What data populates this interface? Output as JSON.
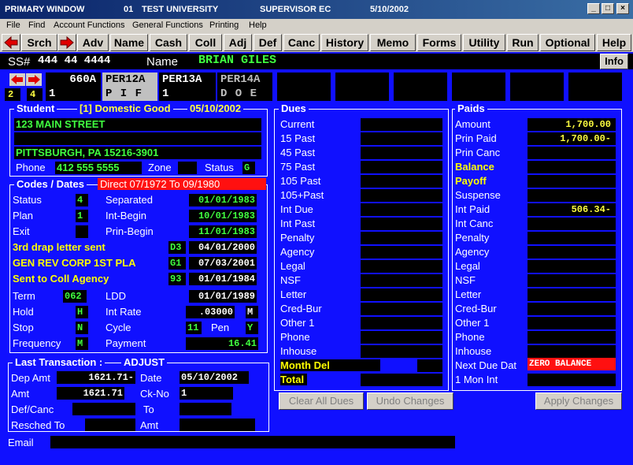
{
  "title": {
    "window": "PRIMARY WINDOW",
    "num": "01",
    "school": "TEST UNIVERSITY",
    "role": "SUPERVISOR",
    "role_code": "EC",
    "date": "5/10/2002"
  },
  "menu": [
    "File",
    "Find",
    "Account Functions",
    "General Functions",
    "Printing",
    "Help"
  ],
  "toolbar": [
    "Srch",
    "Adv",
    "Name",
    "Cash",
    "Coll",
    "Adj",
    "Def",
    "Canc",
    "History",
    "Memo",
    "Forms",
    "Utility",
    "Run",
    "Optional",
    "Help"
  ],
  "header": {
    "ss_label": "SS#",
    "ss": "444 44 4444",
    "name_label": "Name",
    "name": "BRIAN GILES",
    "info": "Info"
  },
  "tabs": [
    "660A",
    "PER12A",
    "PER13A",
    "PER14A"
  ],
  "tabs2": [
    "1",
    "P I F",
    "1",
    "D O E"
  ],
  "mini": [
    "2",
    "4"
  ],
  "student": {
    "title": "Student",
    "status_text": "[1] Domestic Good",
    "date": "05/10/2002",
    "addr1": "123 MAIN STREET",
    "addr2": "",
    "addr3": "PITTSBURGH, PA 15216-3901",
    "phone_label": "Phone",
    "phone": "412 555 5555",
    "zone_label": "Zone",
    "zone": "",
    "status_label": "Status",
    "status": "G"
  },
  "codes": {
    "title": "Codes / Dates",
    "direct": "Direct 07/1972 To 09/1980",
    "rows": [
      {
        "l": "Status",
        "v": "4",
        "l2": "Separated",
        "v2": "01/01/1983"
      },
      {
        "l": "Plan",
        "v": "1",
        "l2": "Int-Begin",
        "v2": "10/01/1983"
      },
      {
        "l": "Exit",
        "v": "",
        "l2": "Prin-Begin",
        "v2": "11/01/1983"
      }
    ],
    "ylines": [
      {
        "l": "3rd drap letter sent",
        "c": "D3",
        "d": "04/01/2000"
      },
      {
        "l": "GEN REV CORP 1ST PLA",
        "c": "G1",
        "d": "07/03/2001"
      },
      {
        "l": "Sent to Coll Agency",
        "c": "93",
        "d": "01/01/1984"
      }
    ],
    "term_label": "Term",
    "term": "062",
    "ldd_label": "LDD",
    "ldd": "01/01/1989",
    "hold_label": "Hold",
    "hold": "H",
    "rate_label": "Int Rate",
    "rate": ".03000",
    "rate_m": "M",
    "stop_label": "Stop",
    "stop": "N",
    "cycle_label": "Cycle",
    "cycle": "11",
    "pen_label": "Pen",
    "pen": "Y",
    "freq_label": "Frequency",
    "freq": "M",
    "pay_label": "Payment",
    "pay": "16.41"
  },
  "last": {
    "title": "Last Transaction :",
    "type": "ADJUST",
    "dep_label": "Dep Amt",
    "dep": "1621.71-",
    "date_label": "Date",
    "date": "05/10/2002",
    "amt_label": "Amt",
    "amt": "1621.71",
    "ck_label": "Ck-No",
    "ck": "1",
    "def_label": "Def/Canc",
    "to_label": "To",
    "resched_label": "Resched To",
    "amt2_label": "Amt"
  },
  "email_label": "Email",
  "dues": {
    "title": "Dues",
    "rows": [
      "Current",
      "15 Past",
      "45 Past",
      "75 Past",
      "105 Past",
      "105+Past",
      "Int Due",
      "Int Past",
      "Penalty",
      "Agency",
      "Legal",
      "NSF",
      "Letter",
      "Cred-Bur",
      "Other 1",
      "Phone",
      "Inhouse"
    ],
    "month_del": "Month Del",
    "total": "Total"
  },
  "paids": {
    "title": "Paids",
    "rows": [
      {
        "l": "Amount",
        "v": "1,700.00"
      },
      {
        "l": "Prin Paid",
        "v": "1,700.00-"
      },
      {
        "l": "Prin Canc",
        "v": ""
      },
      {
        "l": "Balance",
        "v": "",
        "y": true
      },
      {
        "l": "Payoff",
        "v": "",
        "y": true
      },
      {
        "l": "Suspense",
        "v": ""
      },
      {
        "l": "Int Paid",
        "v": "506.34-"
      },
      {
        "l": "Int Canc",
        "v": ""
      },
      {
        "l": "Penalty",
        "v": ""
      },
      {
        "l": "Agency",
        "v": ""
      },
      {
        "l": "Legal",
        "v": ""
      },
      {
        "l": "NSF",
        "v": ""
      },
      {
        "l": "Letter",
        "v": ""
      },
      {
        "l": "Cred-Bur",
        "v": ""
      },
      {
        "l": "Other 1",
        "v": ""
      },
      {
        "l": "Phone",
        "v": ""
      },
      {
        "l": "Inhouse",
        "v": ""
      }
    ],
    "next_due_label": "Next Due Dat",
    "next_due": "ZERO BALANCE",
    "mon_int_label": "1 Mon Int"
  },
  "buttons": {
    "clear": "Clear All Dues",
    "undo": "Undo Changes",
    "apply": "Apply Changes"
  }
}
